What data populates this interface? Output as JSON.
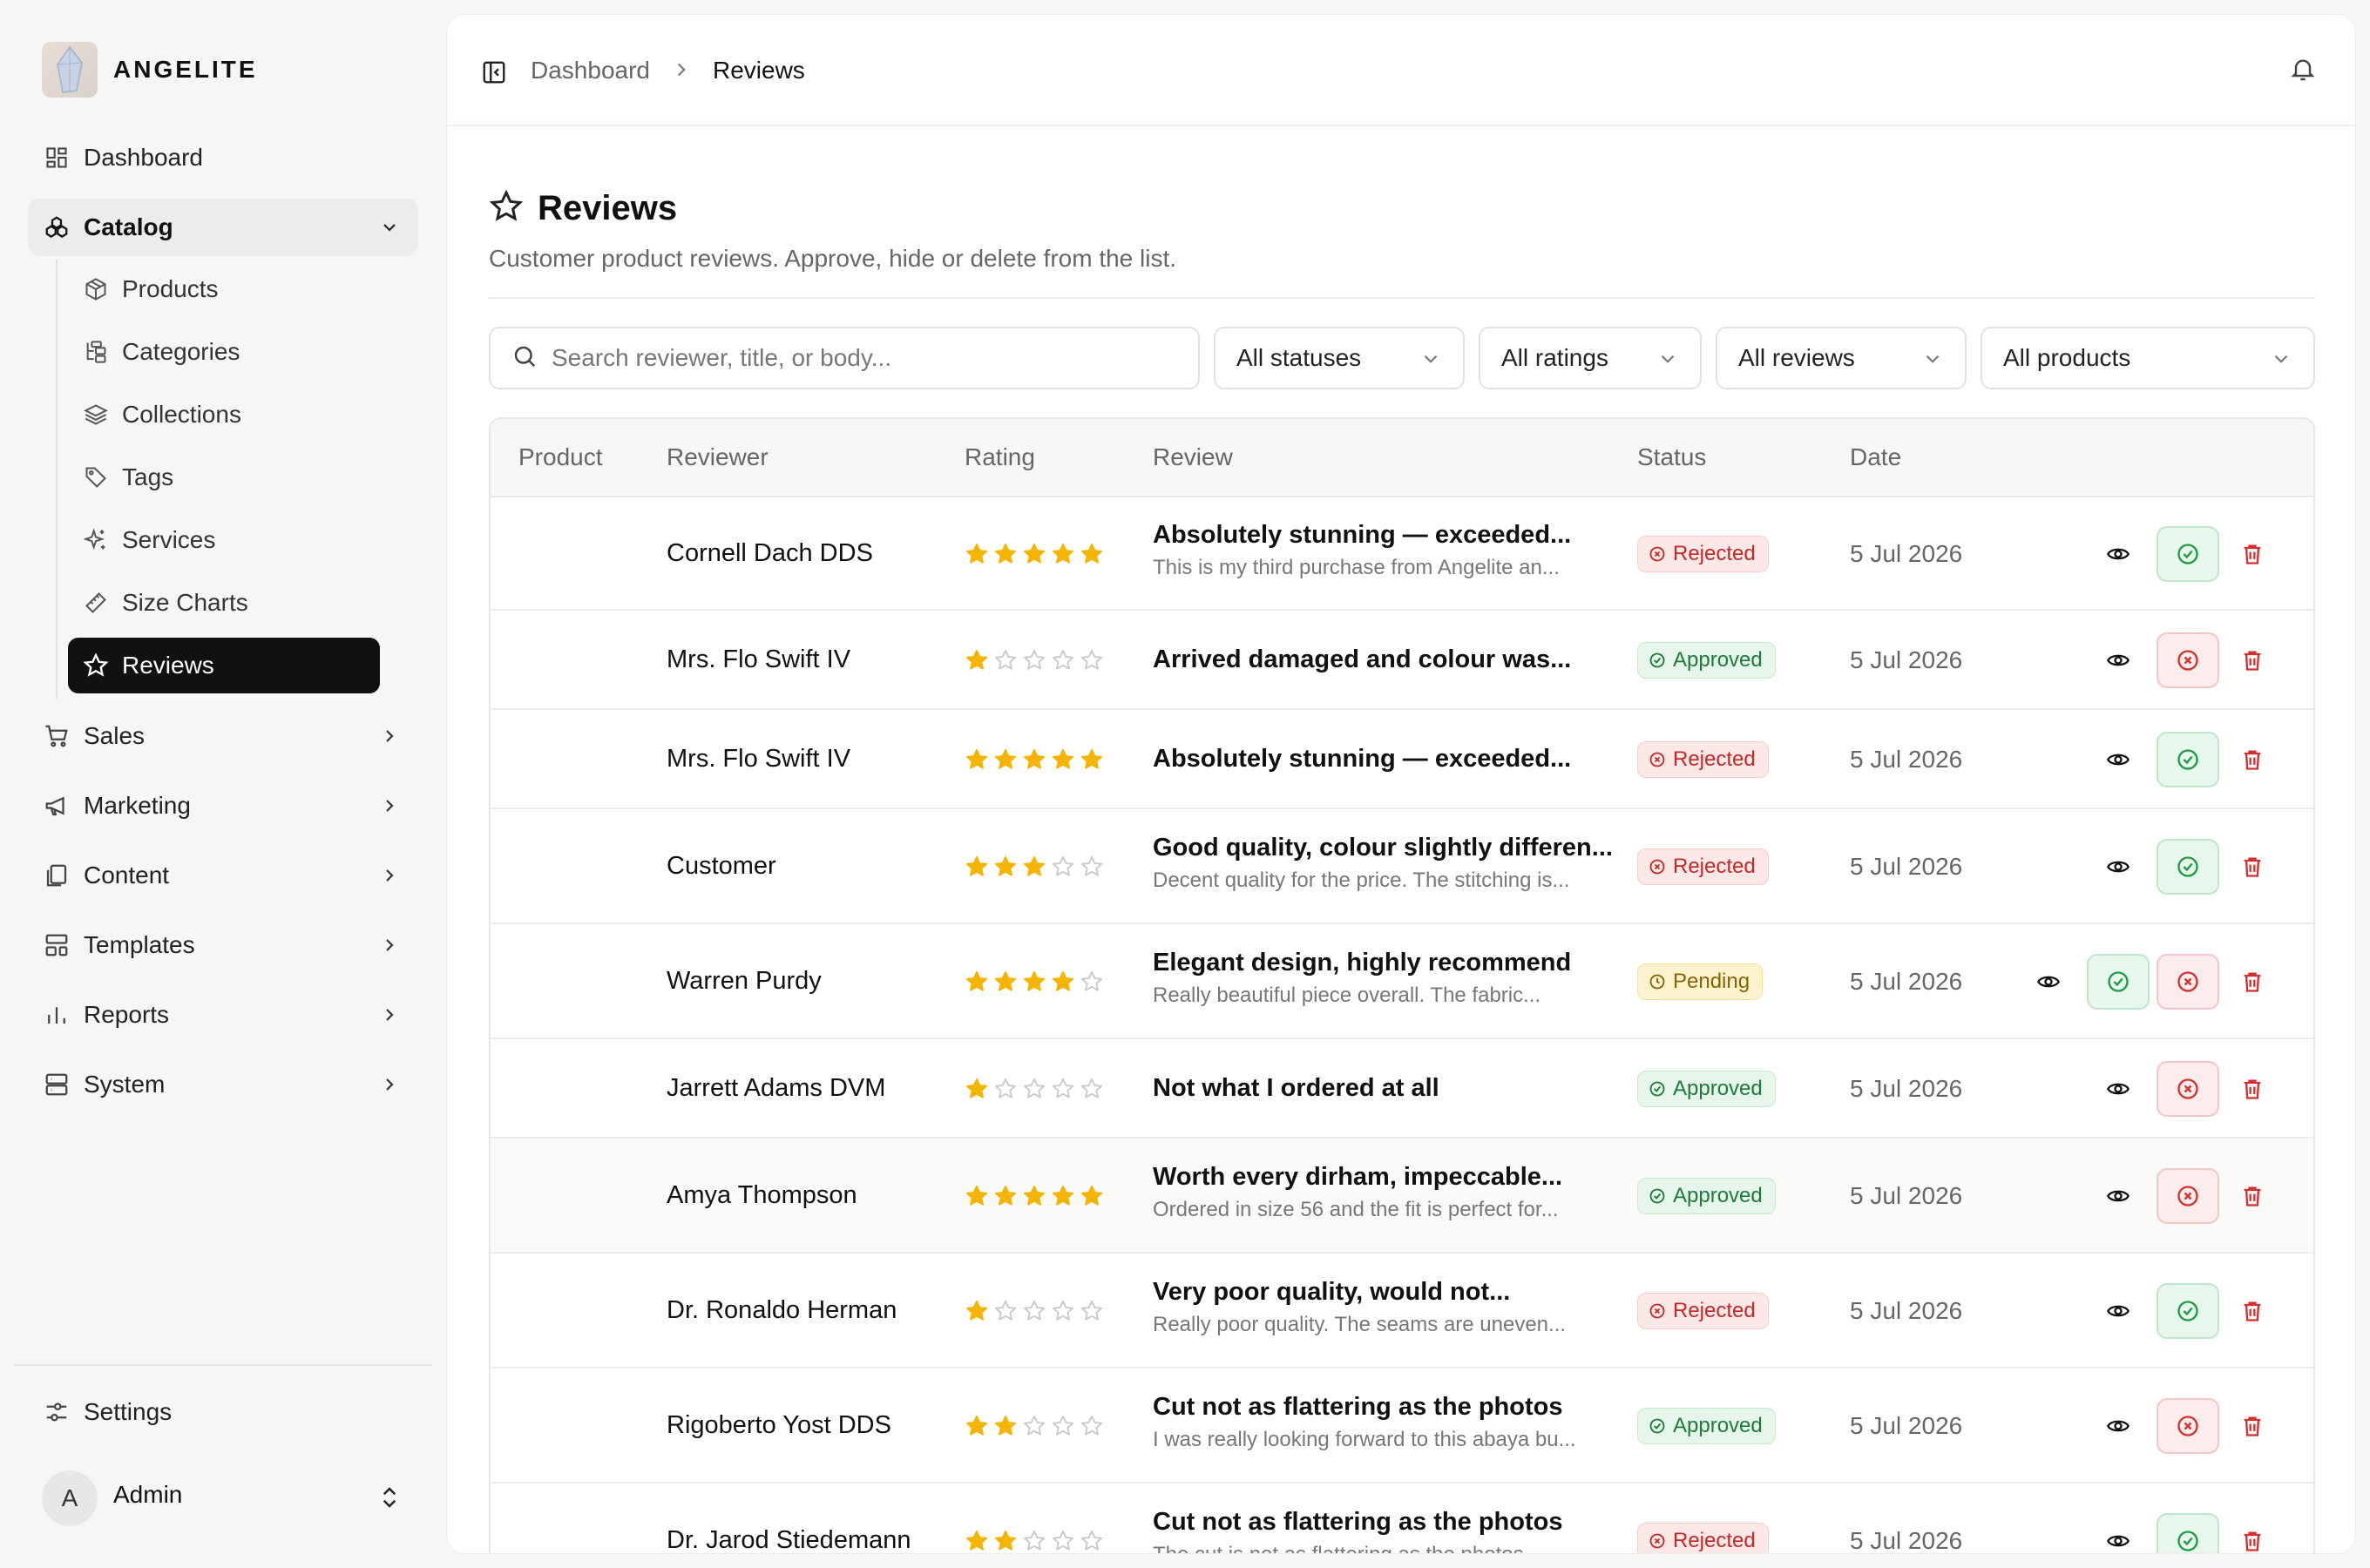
{
  "brand": {
    "name": "ANGELITE"
  },
  "sidebar": {
    "dashboard": "Dashboard",
    "catalog": "Catalog",
    "catalog_items": [
      "Products",
      "Categories",
      "Collections",
      "Tags",
      "Services",
      "Size Charts",
      "Reviews"
    ],
    "sales": "Sales",
    "marketing": "Marketing",
    "content": "Content",
    "templates": "Templates",
    "reports": "Reports",
    "system": "System",
    "settings": "Settings",
    "user": {
      "initial": "A",
      "name": "Admin"
    }
  },
  "breadcrumb": {
    "parent": "Dashboard",
    "current": "Reviews"
  },
  "page": {
    "title": "Reviews",
    "subtitle": "Customer product reviews. Approve, hide or delete from the list."
  },
  "filters": {
    "search_placeholder": "Search reviewer, title, or body...",
    "status": "All statuses",
    "rating": "All ratings",
    "reviews": "All reviews",
    "products": "All products"
  },
  "table": {
    "headers": {
      "product": "Product",
      "reviewer": "Reviewer",
      "rating": "Rating",
      "review": "Review",
      "status": "Status",
      "date": "Date"
    },
    "rows": [
      {
        "reviewer": "Cornell Dach DDS",
        "rating": 5,
        "title": "Absolutely stunning — exceeded...",
        "body": "This is my third purchase from Angelite an...",
        "status": "Rejected",
        "date": "5 Jul 2026"
      },
      {
        "reviewer": "Mrs. Flo Swift IV",
        "rating": 1,
        "title": "Arrived damaged and colour was...",
        "body": "",
        "status": "Approved",
        "date": "5 Jul 2026"
      },
      {
        "reviewer": "Mrs. Flo Swift IV",
        "rating": 5,
        "title": "Absolutely stunning — exceeded...",
        "body": "",
        "status": "Rejected",
        "date": "5 Jul 2026"
      },
      {
        "reviewer": "Customer",
        "rating": 3,
        "title": "Good quality, colour slightly differen...",
        "body": "Decent quality for the price. The stitching is...",
        "status": "Rejected",
        "date": "5 Jul 2026"
      },
      {
        "reviewer": "Warren Purdy",
        "rating": 4,
        "title": "Elegant design, highly recommend",
        "body": "Really beautiful piece overall. The fabric...",
        "status": "Pending",
        "date": "5 Jul 2026"
      },
      {
        "reviewer": "Jarrett Adams DVM",
        "rating": 1,
        "title": "Not what I ordered at all",
        "body": "",
        "status": "Approved",
        "date": "5 Jul 2026"
      },
      {
        "reviewer": "Amya Thompson",
        "rating": 5,
        "title": "Worth every dirham, impeccable...",
        "body": "Ordered in size 56 and the fit is perfect for...",
        "status": "Approved",
        "date": "5 Jul 2026"
      },
      {
        "reviewer": "Dr. Ronaldo Herman",
        "rating": 1,
        "title": "Very poor quality, would not...",
        "body": "Really poor quality. The seams are uneven...",
        "status": "Rejected",
        "date": "5 Jul 2026"
      },
      {
        "reviewer": "Rigoberto Yost DDS",
        "rating": 2,
        "title": "Cut not as flattering as the photos",
        "body": "I was really looking forward to this abaya bu...",
        "status": "Approved",
        "date": "5 Jul 2026"
      },
      {
        "reviewer": "Dr. Jarod Stiedemann",
        "rating": 2,
        "title": "Cut not as flattering as the photos",
        "body": "The cut is not as flattering as the photos",
        "status": "Rejected",
        "date": "5 Jul 2026"
      }
    ]
  },
  "colors": {
    "star_filled": "#f5b400",
    "star_empty": "#c9c9c9",
    "approve": "#1d9a45",
    "reject": "#d32f2f",
    "pending": "#b08300",
    "active_nav": "#111111"
  }
}
